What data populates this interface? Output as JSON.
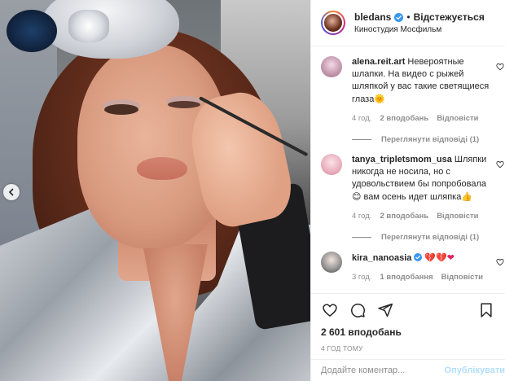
{
  "header": {
    "username": "bledans",
    "separator": "•",
    "follow_state": "Відстежується",
    "location": "Киностудия Мосфильм"
  },
  "comments": [
    {
      "user": "alena.reit.art",
      "text": "Невероятные шлапки. На видео с рыжей шляпкой у вас такие светящиеся глаза",
      "emoji": "🌞",
      "time": "4 год.",
      "likes": "2 вподобань",
      "reply": "Відповісти",
      "view_replies": "Переглянути відповіді (1)"
    },
    {
      "user": "tanya_tripletsmom_usa",
      "text": "Шляпки никогда не носила, но с удовольствием бы попробовала",
      "emoji_mid": "😊",
      "text2": "вам осень идет шляпка",
      "emoji": "👍",
      "time": "4 год.",
      "likes": "2 вподобань",
      "reply": "Відповісти",
      "view_replies": "Переглянути відповіді (1)"
    },
    {
      "user": "kira_nanoasia",
      "verified": true,
      "emoji": "💔💔❤",
      "time": "3 год.",
      "likes": "1 вподобання",
      "reply": "Відповісти"
    }
  ],
  "actions": {
    "likes_count": "2 601 вподобань",
    "timestamp": "4 ГОД ТОМУ"
  },
  "add_comment": {
    "placeholder": "Додайте коментар...",
    "publish_label": "Опублікувати"
  },
  "colors": {
    "verified_blue": "#3897f0",
    "muted_text": "#8e8e8e",
    "publish_disabled": "#b2dffc"
  }
}
